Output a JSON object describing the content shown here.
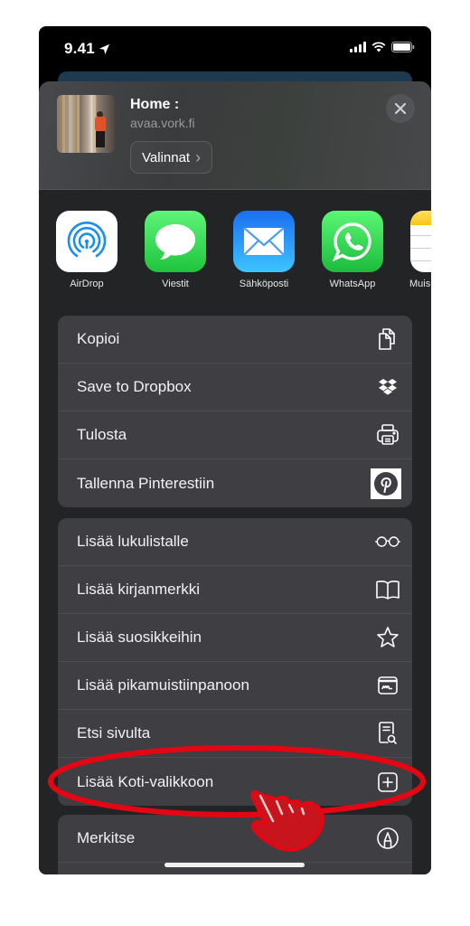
{
  "status_bar": {
    "time": "9.41",
    "location_icon": "location-arrow-icon",
    "signal_icon": "cellular-signal-icon",
    "wifi_icon": "wifi-icon",
    "battery_icon": "battery-icon"
  },
  "share_header": {
    "title": "Home :",
    "url": "avaa.vork.fi",
    "options_label": "Valinnat",
    "options_chevron": "›",
    "close_icon": "close-icon"
  },
  "apps": [
    {
      "label": "AirDrop",
      "icon": "airdrop-icon",
      "color": "#ffffff"
    },
    {
      "label": "Viestit",
      "icon": "messages-icon",
      "color": "#34c759"
    },
    {
      "label": "Sähköposti",
      "icon": "mail-icon",
      "color": "#1e8ef5"
    },
    {
      "label": "WhatsApp",
      "icon": "whatsapp-icon",
      "color": "#2dd05a"
    },
    {
      "label": "Muis",
      "icon": "notes-icon",
      "color": "#ffd43b"
    }
  ],
  "action_groups": [
    {
      "items": [
        {
          "label": "Kopioi",
          "icon": "copy-icon"
        },
        {
          "label": "Save to Dropbox",
          "icon": "dropbox-icon"
        },
        {
          "label": "Tulosta",
          "icon": "printer-icon"
        },
        {
          "label": "Tallenna Pinterestiin",
          "icon": "pinterest-icon"
        }
      ]
    },
    {
      "items": [
        {
          "label": "Lisää lukulistalle",
          "icon": "glasses-icon"
        },
        {
          "label": "Lisää kirjanmerkki",
          "icon": "book-icon"
        },
        {
          "label": "Lisää suosikkeihin",
          "icon": "star-icon"
        },
        {
          "label": "Lisää pikamuistiinpanoon",
          "icon": "quick-note-icon"
        },
        {
          "label": "Etsi sivulta",
          "icon": "find-on-page-icon"
        },
        {
          "label": "Lisää Koti-valikkoon",
          "icon": "add-square-icon"
        }
      ]
    },
    {
      "items": [
        {
          "label": "Merkitse",
          "icon": "markup-icon"
        }
      ]
    }
  ],
  "annotation": {
    "highlighted_item": "Lisää Koti-valikkoon",
    "color": "#e30613"
  }
}
